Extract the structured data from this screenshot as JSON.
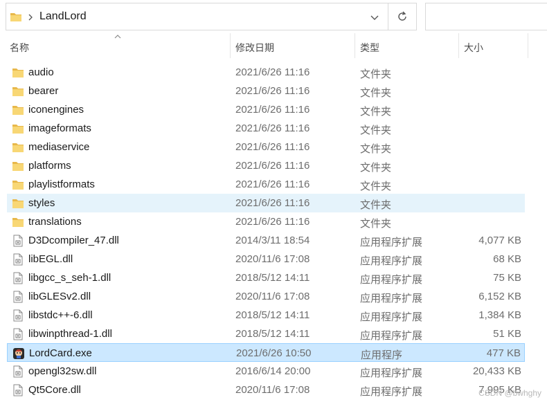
{
  "address": {
    "path": "LandLord",
    "folder_icon": "folder-icon",
    "separator_icon": "chevron-right-icon",
    "dropdown_icon": "chevron-down-icon",
    "refresh_icon": "refresh-icon"
  },
  "columns": {
    "name": "名称",
    "date": "修改日期",
    "type": "类型",
    "size": "大小"
  },
  "files": [
    {
      "name": "audio",
      "date": "2021/6/26 11:16",
      "type": "文件夹",
      "size": "",
      "icon": "folder-icon",
      "state": ""
    },
    {
      "name": "bearer",
      "date": "2021/6/26 11:16",
      "type": "文件夹",
      "size": "",
      "icon": "folder-icon",
      "state": ""
    },
    {
      "name": "iconengines",
      "date": "2021/6/26 11:16",
      "type": "文件夹",
      "size": "",
      "icon": "folder-icon",
      "state": ""
    },
    {
      "name": "imageformats",
      "date": "2021/6/26 11:16",
      "type": "文件夹",
      "size": "",
      "icon": "folder-icon",
      "state": ""
    },
    {
      "name": "mediaservice",
      "date": "2021/6/26 11:16",
      "type": "文件夹",
      "size": "",
      "icon": "folder-icon",
      "state": ""
    },
    {
      "name": "platforms",
      "date": "2021/6/26 11:16",
      "type": "文件夹",
      "size": "",
      "icon": "folder-icon",
      "state": ""
    },
    {
      "name": "playlistformats",
      "date": "2021/6/26 11:16",
      "type": "文件夹",
      "size": "",
      "icon": "folder-icon",
      "state": ""
    },
    {
      "name": "styles",
      "date": "2021/6/26 11:16",
      "type": "文件夹",
      "size": "",
      "icon": "folder-icon",
      "state": "hover"
    },
    {
      "name": "translations",
      "date": "2021/6/26 11:16",
      "type": "文件夹",
      "size": "",
      "icon": "folder-icon",
      "state": ""
    },
    {
      "name": "D3Dcompiler_47.dll",
      "date": "2014/3/11 18:54",
      "type": "应用程序扩展",
      "size": "4,077 KB",
      "icon": "dll-file-icon",
      "state": ""
    },
    {
      "name": "libEGL.dll",
      "date": "2020/11/6 17:08",
      "type": "应用程序扩展",
      "size": "68 KB",
      "icon": "dll-file-icon",
      "state": ""
    },
    {
      "name": "libgcc_s_seh-1.dll",
      "date": "2018/5/12 14:11",
      "type": "应用程序扩展",
      "size": "75 KB",
      "icon": "dll-file-icon",
      "state": ""
    },
    {
      "name": "libGLESv2.dll",
      "date": "2020/11/6 17:08",
      "type": "应用程序扩展",
      "size": "6,152 KB",
      "icon": "dll-file-icon",
      "state": ""
    },
    {
      "name": "libstdc++-6.dll",
      "date": "2018/5/12 14:11",
      "type": "应用程序扩展",
      "size": "1,384 KB",
      "icon": "dll-file-icon",
      "state": ""
    },
    {
      "name": "libwinpthread-1.dll",
      "date": "2018/5/12 14:11",
      "type": "应用程序扩展",
      "size": "51 KB",
      "icon": "dll-file-icon",
      "state": ""
    },
    {
      "name": "LordCard.exe",
      "date": "2021/6/26 10:50",
      "type": "应用程序",
      "size": "477 KB",
      "icon": "app-icon",
      "state": "selected"
    },
    {
      "name": "opengl32sw.dll",
      "date": "2016/6/14 20:00",
      "type": "应用程序扩展",
      "size": "20,433 KB",
      "icon": "dll-file-icon",
      "state": ""
    },
    {
      "name": "Qt5Core.dll",
      "date": "2020/11/6 17:08",
      "type": "应用程序扩展",
      "size": "7,995 KB",
      "icon": "dll-file-icon",
      "state": ""
    }
  ],
  "watermark": "CSDN @bwhghy",
  "colors": {
    "hover_bg": "#e5f3fb",
    "selected_bg": "#cce8ff",
    "folder_yellow": "#f8d775"
  }
}
